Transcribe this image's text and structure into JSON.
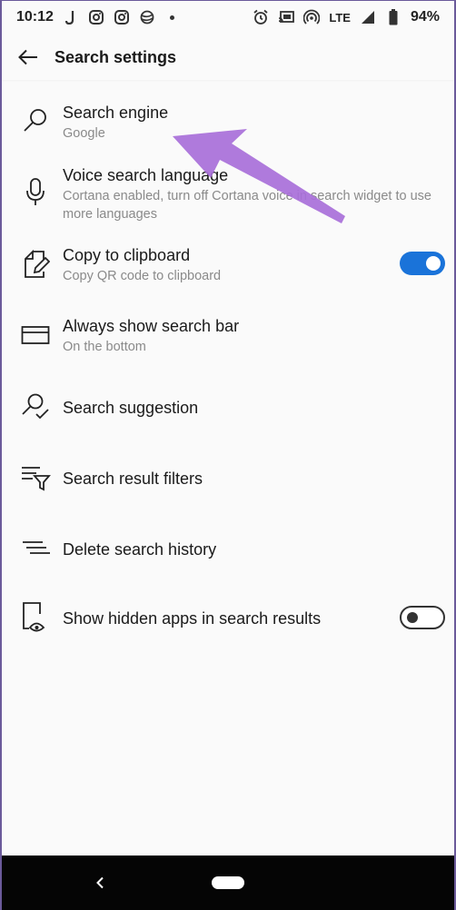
{
  "status_bar": {
    "time": "10:12",
    "network": "LTE",
    "battery": "94%",
    "left_icons": [
      "j-app-icon",
      "instagram-icon",
      "instagram-icon",
      "planet-icon",
      "dot-icon"
    ],
    "right_icons": [
      "alarm-icon",
      "cast-icon",
      "hotspot-icon",
      "signal-icon",
      "battery-icon"
    ]
  },
  "header": {
    "title": "Search settings",
    "back_icon": "arrow-left-icon"
  },
  "settings": [
    {
      "title": "Search engine",
      "subtitle": "Google",
      "icon": "search-icon"
    },
    {
      "title": "Voice search language",
      "subtitle": "Cortana enabled, turn off Cortana voice in search widget to use more languages",
      "icon": "microphone-icon"
    },
    {
      "title": "Copy to clipboard",
      "subtitle": "Copy QR code to clipboard",
      "icon": "clipboard-edit-icon",
      "toggle": true
    },
    {
      "title": "Always show search bar",
      "subtitle": "On the bottom",
      "icon": "search-bar-icon"
    },
    {
      "title": "Search suggestion",
      "icon": "search-check-icon"
    },
    {
      "title": "Search result filters",
      "icon": "filter-list-icon"
    },
    {
      "title": "Delete search history",
      "icon": "lines-icon"
    },
    {
      "title": "Show hidden apps in search results",
      "icon": "phone-eye-icon",
      "toggle": false
    }
  ],
  "colors": {
    "toggle_on": "#1a73d9",
    "annotation_arrow": "#a86fd9",
    "nav_bar": "#050505"
  }
}
